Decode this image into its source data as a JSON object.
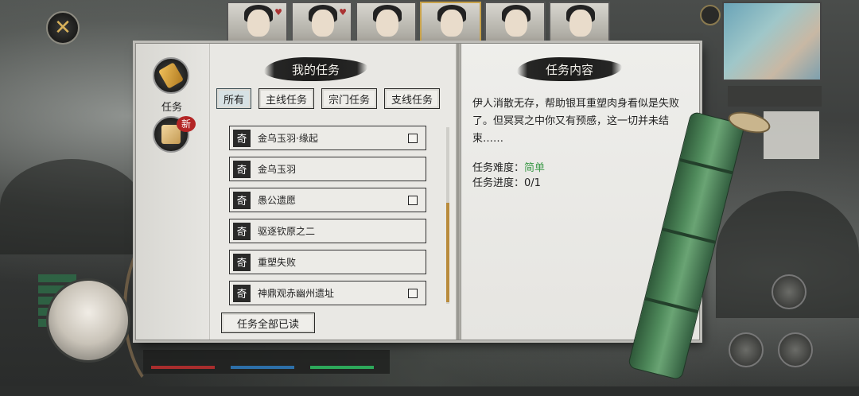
{
  "close_label": "✕",
  "portraits": [
    {
      "suit": "♥",
      "active": false
    },
    {
      "suit": "♥",
      "active": false
    },
    {
      "suit": "",
      "active": false
    },
    {
      "suit": "",
      "active": true
    },
    {
      "suit": "",
      "active": false
    },
    {
      "suit": "",
      "active": false
    }
  ],
  "sidebar": {
    "tasks_label": "任务",
    "new_badge": "新"
  },
  "left_page": {
    "title": "我的任务",
    "tabs": [
      "所有",
      "主线任务",
      "宗门任务",
      "支线任务"
    ],
    "active_tab": 0,
    "tasks": [
      {
        "badge": "奇",
        "name": "金乌玉羽·缘起",
        "checkbox": true
      },
      {
        "badge": "奇",
        "name": "金乌玉羽",
        "checkbox": false
      },
      {
        "badge": "奇",
        "name": "愚公遗愿",
        "checkbox": true
      },
      {
        "badge": "奇",
        "name": "驱逐钦原之二",
        "checkbox": false
      },
      {
        "badge": "奇",
        "name": "重塑失败",
        "checkbox": false
      },
      {
        "badge": "奇",
        "name": "神鼎观赤幽州遗址",
        "checkbox": true
      }
    ],
    "read_all_label": "任务全部已读"
  },
  "right_page": {
    "title": "任务内容",
    "description": "伊人消散无存，帮助银耳重塑肉身看似是失败了。但冥冥之中你又有预感，这一切并未结束……",
    "difficulty_label": "任务难度：",
    "difficulty_value": "简单",
    "progress_label": "任务进度：",
    "progress_value": "0/1"
  },
  "colors": {
    "difficulty_easy": "#3f9a4b",
    "new_badge": "#b32525",
    "scroll_thumb": "#b98b3c"
  }
}
